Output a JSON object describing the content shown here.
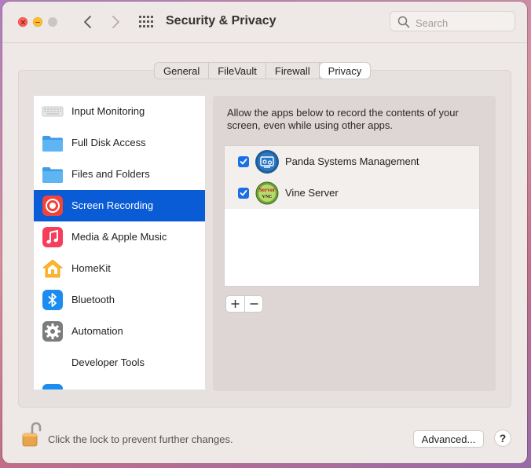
{
  "window": {
    "title": "Security & Privacy",
    "search_placeholder": "Search"
  },
  "tabs": [
    {
      "label": "General",
      "active": false
    },
    {
      "label": "FileVault",
      "active": false
    },
    {
      "label": "Firewall",
      "active": false
    },
    {
      "label": "Privacy",
      "active": true
    }
  ],
  "sidebar": {
    "items": [
      {
        "label": "Input Monitoring",
        "icon": "keyboard-icon"
      },
      {
        "label": "Full Disk Access",
        "icon": "folder-icon"
      },
      {
        "label": "Files and Folders",
        "icon": "folder-icon"
      },
      {
        "label": "Screen Recording",
        "icon": "screen-recording-icon",
        "selected": true
      },
      {
        "label": "Media & Apple Music",
        "icon": "music-icon"
      },
      {
        "label": "HomeKit",
        "icon": "homekit-icon"
      },
      {
        "label": "Bluetooth",
        "icon": "bluetooth-icon"
      },
      {
        "label": "Automation",
        "icon": "gear-icon"
      },
      {
        "label": "Developer Tools",
        "icon": ""
      }
    ]
  },
  "content": {
    "description_line1": "Allow the apps below to record the contents of your",
    "description_line2": "screen, even while using other apps.",
    "apps": [
      {
        "name": "Panda Systems Management",
        "checked": true,
        "icon": "panda-app-icon"
      },
      {
        "name": "Vine Server",
        "checked": true,
        "icon": "vine-server-icon",
        "icon_text_top": "Server",
        "icon_text_bottom": "VNC"
      }
    ]
  },
  "footer": {
    "lock_text": "Click the lock to prevent further changes.",
    "advanced_label": "Advanced...",
    "help_label": "?"
  },
  "colors": {
    "selection": "#0a5bd6",
    "checkbox": "#1a6fe8",
    "window_bg": "#eee8e6"
  }
}
